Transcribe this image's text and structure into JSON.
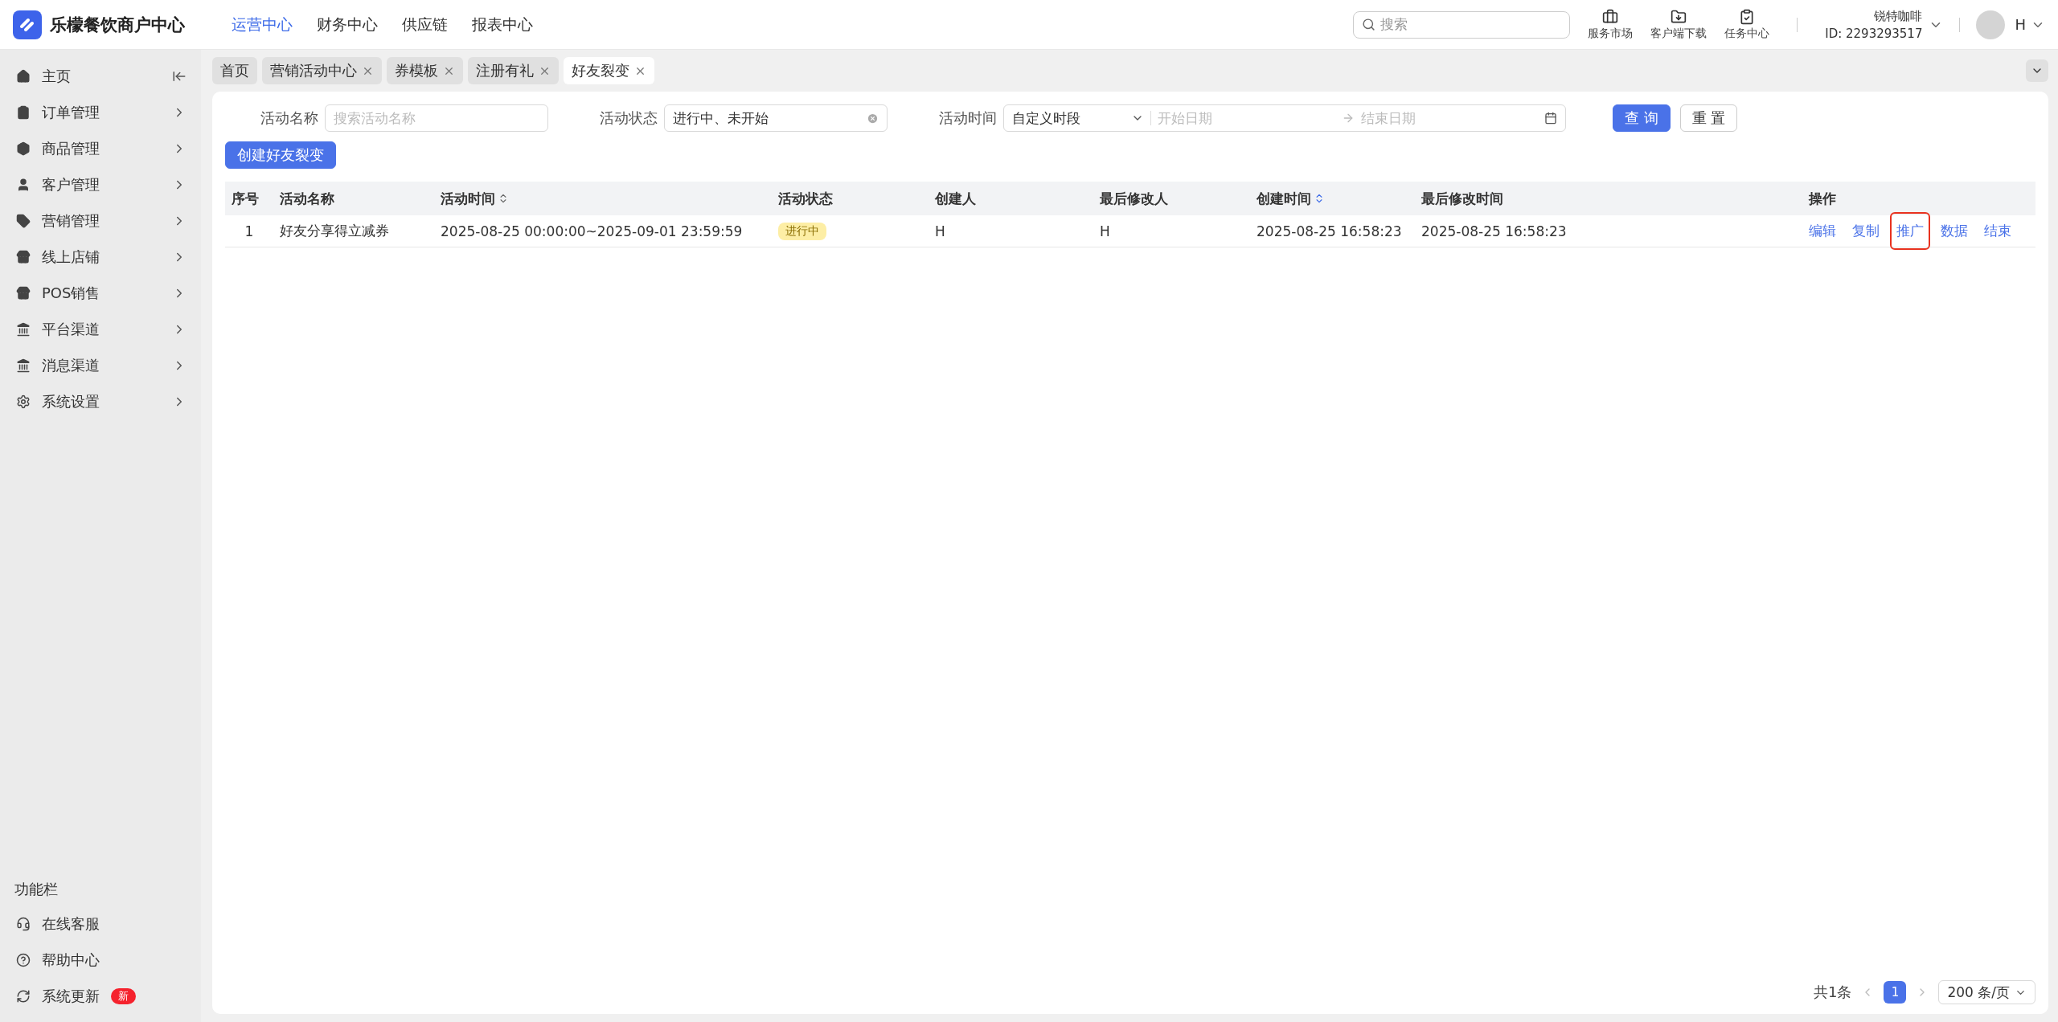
{
  "brand": {
    "name": "乐檬餐饮商户中心"
  },
  "top_nav": [
    {
      "label": "运营中心",
      "selected": true
    },
    {
      "label": "财务中心",
      "selected": false
    },
    {
      "label": "供应链",
      "selected": false
    },
    {
      "label": "报表中心",
      "selected": false
    }
  ],
  "search": {
    "placeholder": "搜索"
  },
  "top_tools": [
    {
      "label": "服务市场"
    },
    {
      "label": "客户端下载"
    },
    {
      "label": "任务中心"
    }
  ],
  "account": {
    "name": "锐特咖啡",
    "id": "ID: 2293293517"
  },
  "user": {
    "name": "H"
  },
  "sidebar": {
    "items": [
      {
        "label": "主页"
      },
      {
        "label": "订单管理"
      },
      {
        "label": "商品管理"
      },
      {
        "label": "客户管理"
      },
      {
        "label": "营销管理"
      },
      {
        "label": "线上店铺"
      },
      {
        "label": "POS销售"
      },
      {
        "label": "平台渠道"
      },
      {
        "label": "消息渠道"
      },
      {
        "label": "系统设置"
      }
    ],
    "footer_title": "功能栏",
    "footer_items": [
      {
        "label": "在线客服"
      },
      {
        "label": "帮助中心"
      },
      {
        "label": "系统更新",
        "badge": "新"
      }
    ]
  },
  "tabs": [
    {
      "label": "首页",
      "closable": false,
      "selected": false
    },
    {
      "label": "营销活动中心",
      "closable": true,
      "selected": false
    },
    {
      "label": "券模板",
      "closable": true,
      "selected": false
    },
    {
      "label": "注册有礼",
      "closable": true,
      "selected": false
    },
    {
      "label": "好友裂变",
      "closable": true,
      "selected": true
    }
  ],
  "filters": {
    "name_label": "活动名称",
    "name_placeholder": "搜索活动名称",
    "status_label": "活动状态",
    "status_value": "进行中、未开始",
    "time_label": "活动时间",
    "time_mode": "自定义时段",
    "start_placeholder": "开始日期",
    "end_placeholder": "结束日期",
    "query": "查 询",
    "reset": "重 置"
  },
  "create_button": "创建好友裂变",
  "table": {
    "columns": [
      {
        "label": "序号",
        "sortable": false
      },
      {
        "label": "活动名称",
        "sortable": false
      },
      {
        "label": "活动时间",
        "sortable": true,
        "sorted": false
      },
      {
        "label": "活动状态",
        "sortable": false
      },
      {
        "label": "创建人",
        "sortable": false
      },
      {
        "label": "最后修改人",
        "sortable": false
      },
      {
        "label": "创建时间",
        "sortable": true,
        "sorted": true
      },
      {
        "label": "最后修改时间",
        "sortable": false
      },
      {
        "label": "操作",
        "sortable": false
      }
    ],
    "rows": [
      {
        "index": "1",
        "name": "好友分享得立减券",
        "time": "2025-08-25 00:00:00~2025-09-01 23:59:59",
        "status": "进行中",
        "creator": "H",
        "modifier": "H",
        "created": "2025-08-25 16:58:23",
        "modified": "2025-08-25 16:58:23",
        "actions": [
          {
            "label": "编辑",
            "highlighted": false
          },
          {
            "label": "复制",
            "highlighted": false
          },
          {
            "label": "推广",
            "highlighted": true
          },
          {
            "label": "数据",
            "highlighted": false
          },
          {
            "label": "结束",
            "highlighted": false
          }
        ]
      }
    ]
  },
  "pagination": {
    "total": "共1条",
    "pages": [
      {
        "label": "1",
        "selected": true
      }
    ],
    "page_size": "200 条/页"
  }
}
